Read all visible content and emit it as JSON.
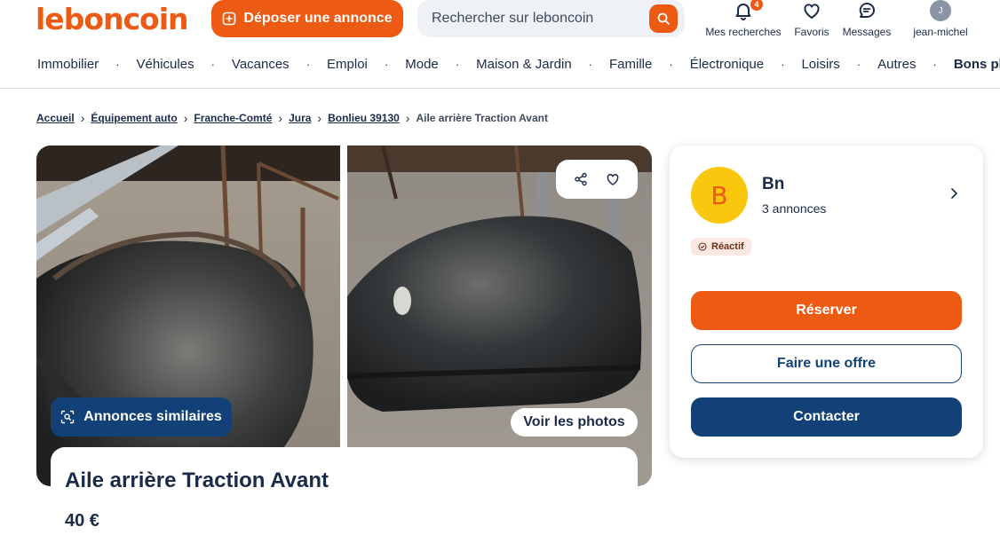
{
  "header": {
    "logo": "leboncoin",
    "post_label": "Déposer une annonce",
    "search_placeholder": "Rechercher sur leboncoin",
    "icons": [
      {
        "label": "Mes recherches",
        "badge": "4"
      },
      {
        "label": "Favoris"
      },
      {
        "label": "Messages"
      },
      {
        "label": "jean-michel",
        "initial": "J"
      }
    ]
  },
  "categories": [
    "Immobilier",
    "Véhicules",
    "Vacances",
    "Emploi",
    "Mode",
    "Maison & Jardin",
    "Famille",
    "Électronique",
    "Loisirs",
    "Autres",
    "Bons plans !"
  ],
  "breadcrumb": [
    "Accueil",
    "Équipement auto",
    "Franche-Comté",
    "Jura",
    "Bonlieu 39130",
    "Aile arrière Traction Avant"
  ],
  "gallery": {
    "similar_label": "Annonces similaires",
    "photos_label": "Voir les photos"
  },
  "listing": {
    "title": "Aile arrière Traction Avant",
    "price": "40 €"
  },
  "seller": {
    "initial": "B",
    "name": "Bn",
    "count": "3 annonces",
    "badge": "Réactif",
    "reserve_label": "Réserver",
    "offer_label": "Faire une offre",
    "contact_label": "Contacter"
  },
  "colors": {
    "brand": "#ec5a13",
    "navy": "#124178",
    "text": "#1a2b49"
  }
}
